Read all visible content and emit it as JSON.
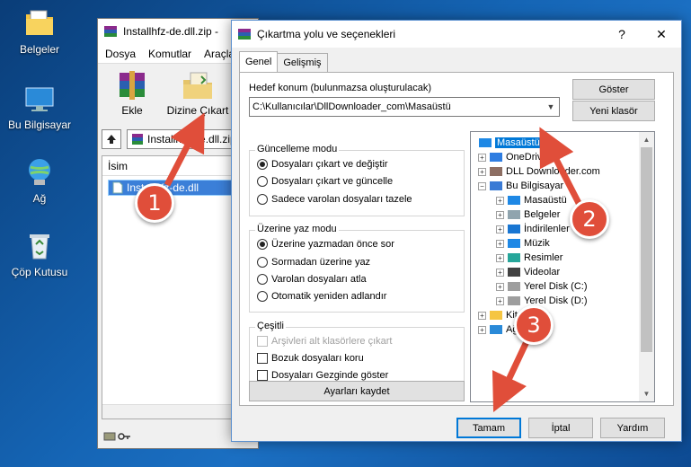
{
  "desktop": {
    "icons": [
      {
        "label": "Belgeler",
        "icon": "documents-folder-icon"
      },
      {
        "label": "Bu Bilgisayar",
        "icon": "computer-icon"
      },
      {
        "label": "Ağ",
        "icon": "network-icon"
      },
      {
        "label": "Çöp Kutusu",
        "icon": "recycle-bin-icon"
      }
    ]
  },
  "winrar": {
    "title": "Installhfz-de.dll.zip -",
    "menu": [
      "Dosya",
      "Komutlar",
      "Araçla"
    ],
    "toolbar": {
      "add": "Ekle",
      "extract_to": "Dizine Çıkart"
    },
    "path": "Installhfz-de.dll.zip",
    "column_name": "İsim",
    "file": "Installhfz-de.dll"
  },
  "dialog": {
    "title": "Çıkartma yolu ve seçenekleri",
    "help_glyph": "?",
    "close_glyph": "✕",
    "tabs": [
      "Genel",
      "Gelişmiş"
    ],
    "dest_label": "Hedef konum (bulunmazsa oluşturulacak)",
    "dest_value": "C:\\Kullanıcılar\\DllDownloader_com\\Masaüstü",
    "show_button": "Göster",
    "new_folder_button": "Yeni klasör",
    "update_mode": {
      "title": "Güncelleme modu",
      "options": [
        "Dosyaları çıkart ve değiştir",
        "Dosyaları çıkart ve güncelle",
        "Sadece varolan dosyaları tazele"
      ],
      "selected": 0
    },
    "overwrite_mode": {
      "title": "Üzerine yaz modu",
      "options": [
        "Üzerine yazmadan önce sor",
        "Sormadan üzerine yaz",
        "Varolan dosyaları atla",
        "Otomatik yeniden adlandır"
      ],
      "selected": 0
    },
    "misc": {
      "title": "Çeşitli",
      "options": [
        "Arşivleri alt klasörlere çıkart",
        "Bozuk dosyaları koru",
        "Dosyaları Gezginde göster"
      ],
      "disabled": [
        true,
        false,
        false
      ]
    },
    "save_settings": "Ayarları kaydet",
    "tree": [
      {
        "label": "Masaüstü",
        "icon": "desktop-icon",
        "level": 0,
        "selected": true
      },
      {
        "label": "OneDrive",
        "icon": "onedrive-icon",
        "level": 1,
        "exp": "+"
      },
      {
        "label": "DLL Downloader.com",
        "icon": "user-icon",
        "level": 1,
        "exp": "+"
      },
      {
        "label": "Bu Bilgisayar",
        "icon": "computer-icon",
        "level": 1,
        "exp": "−"
      },
      {
        "label": "Masaüstü",
        "icon": "desktop-icon",
        "level": 2,
        "exp": "+"
      },
      {
        "label": "Belgeler",
        "icon": "documents-icon",
        "level": 2,
        "exp": "+"
      },
      {
        "label": "İndirilenler",
        "icon": "downloads-icon",
        "level": 2,
        "exp": "+"
      },
      {
        "label": "Müzik",
        "icon": "music-icon",
        "level": 2,
        "exp": "+"
      },
      {
        "label": "Resimler",
        "icon": "pictures-icon",
        "level": 2,
        "exp": "+"
      },
      {
        "label": "Videolar",
        "icon": "videos-icon",
        "level": 2,
        "exp": "+"
      },
      {
        "label": "Yerel Disk (C:)",
        "icon": "disk-icon",
        "level": 2,
        "exp": "+"
      },
      {
        "label": "Yerel Disk (D:)",
        "icon": "disk-icon",
        "level": 2,
        "exp": "+"
      },
      {
        "label": "Kitaplıklar",
        "icon": "libraries-icon",
        "level": 1,
        "exp": "+"
      },
      {
        "label": "Ağ",
        "icon": "network-icon",
        "level": 1,
        "exp": "+"
      }
    ],
    "ok_button": "Tamam",
    "cancel_button": "İptal",
    "help_button": "Yardım"
  },
  "annotations": [
    "1",
    "2",
    "3"
  ],
  "colors": {
    "accent": "#0078d7",
    "badge": "#e04e3a",
    "arrow": "#e04e3a"
  }
}
